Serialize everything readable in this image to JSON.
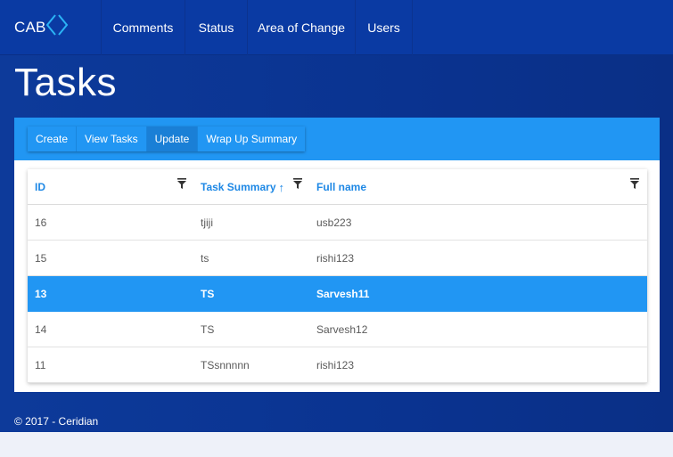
{
  "navbar": {
    "brand": "CAB",
    "items": [
      "Comments",
      "Status",
      "Area of Change",
      "Users"
    ]
  },
  "page": {
    "title": "Tasks"
  },
  "toolbar": {
    "buttons": [
      "Create",
      "View Tasks",
      "Update",
      "Wrap Up Summary"
    ],
    "active": "Update"
  },
  "grid": {
    "columns": [
      "ID",
      "Task Summary",
      "Full name"
    ],
    "sort_indicator": "↑",
    "rows": [
      {
        "id": "16",
        "summary": "tjiji",
        "name": "usb223"
      },
      {
        "id": "15",
        "summary": "ts",
        "name": "rishi123"
      },
      {
        "id": "13",
        "summary": "TS",
        "name": "Sarvesh11"
      },
      {
        "id": "14",
        "summary": "TS",
        "name": "Sarvesh12"
      },
      {
        "id": "11",
        "summary": "TSsnnnnn",
        "name": "rishi123"
      }
    ],
    "selected_row_id": "13"
  },
  "footer": {
    "text": "© 2017 - Ceridian"
  },
  "colors": {
    "navbar": "#0a3aa3",
    "background": "#0a3390",
    "accent": "#2196f3",
    "header_text": "#1e88e5"
  }
}
